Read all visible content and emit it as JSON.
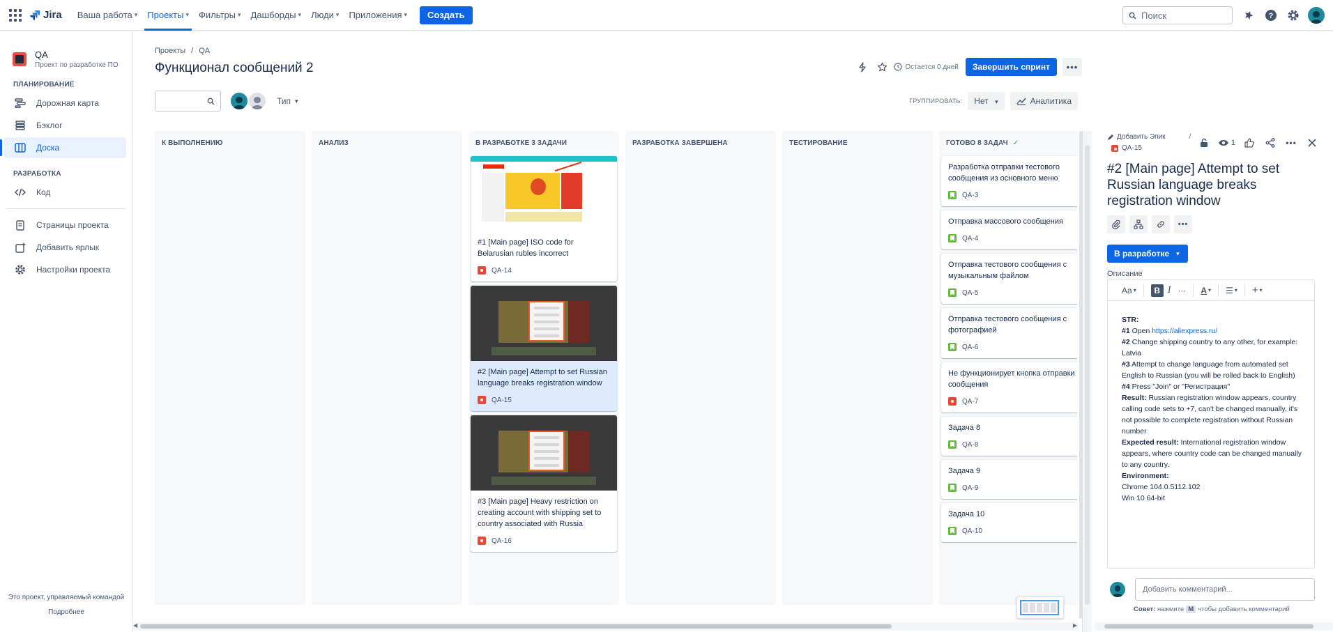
{
  "topnav": {
    "logo": "Jira",
    "items": [
      {
        "label": "Ваша работа",
        "active": false
      },
      {
        "label": "Проекты",
        "active": true
      },
      {
        "label": "Фильтры",
        "active": false
      },
      {
        "label": "Дашборды",
        "active": false
      },
      {
        "label": "Люди",
        "active": false
      },
      {
        "label": "Приложения",
        "active": false
      }
    ],
    "create_label": "Создать",
    "search_placeholder": "Поиск"
  },
  "sidebar": {
    "project_name": "QA",
    "project_sub": "Проект по разработке ПО",
    "section_planning": "ПЛАНИРОВАНИЕ",
    "planning_items": [
      {
        "label": "Дорожная карта",
        "icon": "roadmap-icon"
      },
      {
        "label": "Бэклог",
        "icon": "backlog-icon"
      },
      {
        "label": "Доска",
        "icon": "board-icon",
        "active": true
      }
    ],
    "section_dev": "РАЗРАБОТКА",
    "dev_items": [
      {
        "label": "Код",
        "icon": "code-icon"
      }
    ],
    "other_items": [
      {
        "label": "Страницы проекта",
        "icon": "pages-icon"
      },
      {
        "label": "Добавить ярлык",
        "icon": "add-shortcut-icon"
      },
      {
        "label": "Настройки проекта",
        "icon": "settings-icon"
      }
    ],
    "footer_text": "Это проект, управляемый командой",
    "footer_link": "Подробнее"
  },
  "main": {
    "breadcrumbs": [
      "Проекты",
      "QA"
    ],
    "title": "Функционал сообщений 2",
    "days_left": "Остается 0 дней",
    "finish_sprint": "Завершить спринт",
    "more": "•••",
    "type_filter": "Тип",
    "group_by_label": "ГРУППИРОВАТЬ:",
    "group_by_value": "Нет",
    "analytics": "Аналитика"
  },
  "board": {
    "columns": [
      {
        "title": "К ВЫПОЛНЕНИЮ"
      },
      {
        "title": "АНАЛИЗ"
      },
      {
        "title": "В РАЗРАБОТКЕ 3 ЗАДАЧИ"
      },
      {
        "title": "РАЗРАБОТКА ЗАВЕРШЕНА"
      },
      {
        "title": "ТЕСТИРОВАНИЕ"
      },
      {
        "title": "ГОТОВО 8 ЗАДАЧ"
      }
    ],
    "dev_cards": [
      {
        "title": "#1 [Main page] ISO code for Belarusian rubles incorrect",
        "key": "QA-14"
      },
      {
        "title": "#2 [Main page] Attempt to set Russian language breaks registration window",
        "key": "QA-15",
        "selected": true
      },
      {
        "title": "#3 [Main page] Heavy restriction on creating account with shipping set to country associated with Russia",
        "key": "QA-16"
      }
    ],
    "done_cards": [
      {
        "title": "Разработка отправки тестового сообщения из основного меню",
        "key": "QA-3"
      },
      {
        "title": "Отправка массового сообщения",
        "key": "QA-4"
      },
      {
        "title": "Отправка тестового сообщения с музыкальным файлом",
        "key": "QA-5"
      },
      {
        "title": "Отправка тестового сообщения с фотографией",
        "key": "QA-6"
      },
      {
        "title": "Не функционирует кнопка отправки сообщения",
        "key": "QA-7",
        "bug": true
      },
      {
        "title": "Задача 8",
        "key": "QA-8"
      },
      {
        "title": "Задача 9",
        "key": "QA-9"
      },
      {
        "title": "Задача 10",
        "key": "QA-10"
      }
    ]
  },
  "panel": {
    "add_epic": "Добавить Эпик",
    "issue_key": "QA-15",
    "watchers": "1",
    "title": "#2 [Main page] Attempt to set Russian language breaks registration window",
    "status": "В разработке",
    "description_label": "Описание",
    "toolbar_text_style": "Aa",
    "description": {
      "str": "STR:",
      "s1_num": "#1",
      "s1_text": " Open ",
      "s1_link": "https://aliexpress.ru/",
      "s2_num": "#2",
      "s2_text": " Change shipping country to any other, for example: Latvia",
      "s3_num": "#3",
      "s3_text": " Attempt to change language from automated set English to Russian (you will be rolled back to English)",
      "s4_num": "#4",
      "s4_text": " Press \"Join\" or \"Регистрация\"",
      "result_label": "Result:",
      "result_text": " Russian registration window appears, country calling code sets to +7, can't be changed manually, it's not possible to complete registration without Russian number",
      "expected_label": "Expected result:",
      "expected_text": " International registration window appears, where country code can be changed manually to any country.",
      "env_label": "Environment:",
      "env_1": "Chrome 104.0.5112.102",
      "env_2": "Win 10 64-bit"
    },
    "comment_placeholder": "Добавить комментарий...",
    "tip_label": "Совет:",
    "tip_pre": "нажмите",
    "tip_key": "M",
    "tip_post": "чтобы добавить комментарий"
  },
  "colors": {
    "accent": "#0c66e4",
    "selected_card": "#deebff",
    "bug": "#e5493a",
    "story": "#63ba3c"
  }
}
